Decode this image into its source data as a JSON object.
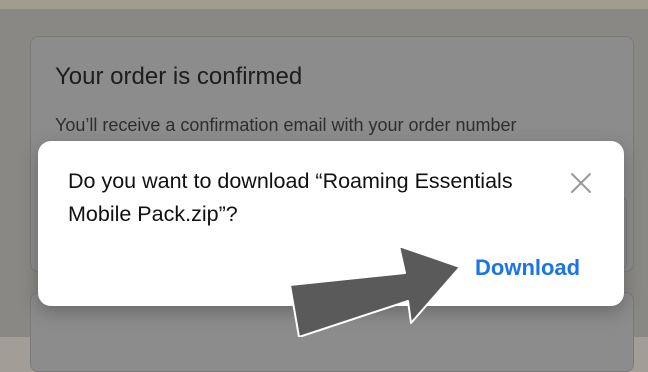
{
  "order_card": {
    "title": "Your order is confirmed",
    "subtitle": "You’ll receive a confirmation email with your order number"
  },
  "download_dialog": {
    "message": "Do you want to download “Roaming Essentials Mobile Pack.zip”?",
    "close_icon": "close-icon",
    "download_label": "Download",
    "accent_color": "#1b74e8"
  },
  "annotation": {
    "arrow_icon": "arrow-icon",
    "arrow_color": "#5a5a5a"
  }
}
